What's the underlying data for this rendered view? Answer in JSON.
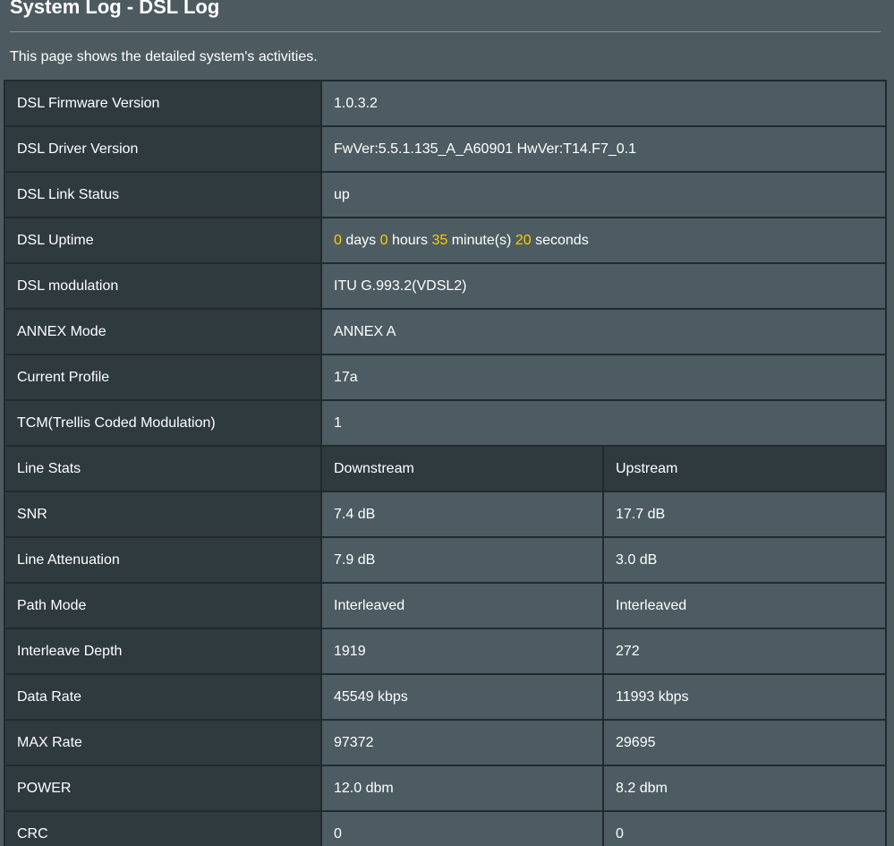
{
  "header": {
    "title": "System Log - DSL Log",
    "description": "This page shows the detailed system's activities."
  },
  "info_rows": [
    {
      "label": "DSL Firmware Version",
      "value": "1.0.3.2"
    },
    {
      "label": "DSL Driver Version",
      "value": "FwVer:5.5.1.135_A_A60901 HwVer:T14.F7_0.1"
    },
    {
      "label": "DSL Link Status",
      "value": "up"
    }
  ],
  "uptime": {
    "label": "DSL Uptime",
    "days": "0",
    "days_unit": "days",
    "hours": "0",
    "hours_unit": "hours",
    "minutes": "35",
    "minutes_unit": "minute(s)",
    "seconds": "20",
    "seconds_unit": "seconds"
  },
  "info_rows2": [
    {
      "label": "DSL modulation",
      "value": "ITU G.993.2(VDSL2)"
    },
    {
      "label": "ANNEX Mode",
      "value": "ANNEX A"
    },
    {
      "label": "Current Profile",
      "value": "17a"
    },
    {
      "label": "TCM(Trellis Coded Modulation)",
      "value": "1"
    }
  ],
  "line_stats": {
    "label": "Line Stats",
    "downstream_header": "Downstream",
    "upstream_header": "Upstream",
    "rows": [
      {
        "label": "SNR",
        "down": "7.4 dB",
        "up": "17.7 dB"
      },
      {
        "label": "Line Attenuation",
        "down": "7.9 dB",
        "up": "3.0 dB"
      },
      {
        "label": "Path Mode",
        "down": "Interleaved",
        "up": "Interleaved"
      },
      {
        "label": "Interleave Depth",
        "down": "1919",
        "up": "272"
      },
      {
        "label": "Data Rate",
        "down": "45549 kbps",
        "up": "11993 kbps"
      },
      {
        "label": "MAX Rate",
        "down": "97372",
        "up": "29695"
      },
      {
        "label": "POWER",
        "down": "12.0 dbm",
        "up": "8.2 dbm"
      },
      {
        "label": "CRC",
        "down": "0",
        "up": "0"
      }
    ]
  },
  "colors": {
    "highlight": "#ffcc00",
    "label_cell": "#2f3a3f",
    "value_cell": "#4d5c62",
    "border": "#222a2e"
  }
}
